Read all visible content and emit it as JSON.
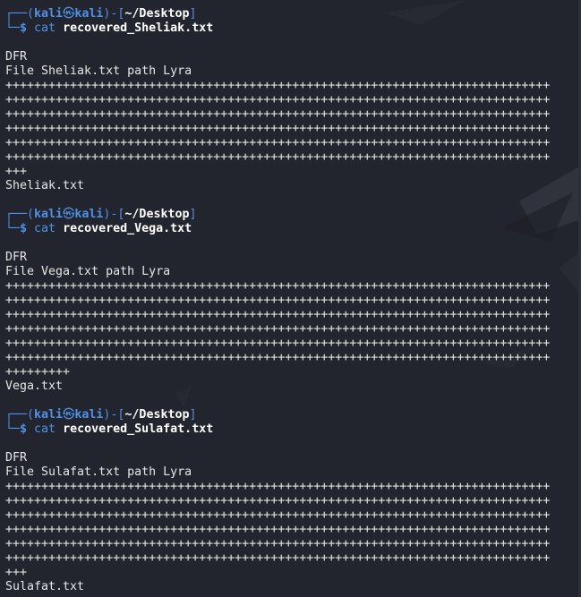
{
  "prompt": {
    "top_open": "┌──(",
    "user": "kali",
    "at_icon": "㉿",
    "host": "kali",
    "mid": ")-[",
    "path": "~/Desktop",
    "close": "]",
    "bottom": "└─",
    "dollar": "$"
  },
  "blocks": [
    {
      "command": "cat",
      "argument": "recovered_Sheliak.txt",
      "output": [
        "",
        "DFR",
        "File Sheliak.txt path Lyra",
        "++++++++++++++++++++++++++++++++++++++++++++++++++++++++++++++++++++++++++++",
        "++++++++++++++++++++++++++++++++++++++++++++++++++++++++++++++++++++++++++++",
        "++++++++++++++++++++++++++++++++++++++++++++++++++++++++++++++++++++++++++++",
        "++++++++++++++++++++++++++++++++++++++++++++++++++++++++++++++++++++++++++++",
        "++++++++++++++++++++++++++++++++++++++++++++++++++++++++++++++++++++++++++++",
        "++++++++++++++++++++++++++++++++++++++++++++++++++++++++++++++++++++++++++++",
        "+++",
        "Sheliak.txt"
      ]
    },
    {
      "command": "cat",
      "argument": "recovered_Vega.txt",
      "output": [
        "",
        "DFR",
        "File Vega.txt path Lyra",
        "++++++++++++++++++++++++++++++++++++++++++++++++++++++++++++++++++++++++++++",
        "++++++++++++++++++++++++++++++++++++++++++++++++++++++++++++++++++++++++++++",
        "++++++++++++++++++++++++++++++++++++++++++++++++++++++++++++++++++++++++++++",
        "++++++++++++++++++++++++++++++++++++++++++++++++++++++++++++++++++++++++++++",
        "++++++++++++++++++++++++++++++++++++++++++++++++++++++++++++++++++++++++++++",
        "++++++++++++++++++++++++++++++++++++++++++++++++++++++++++++++++++++++++++++",
        "+++++++++",
        "Vega.txt"
      ]
    },
    {
      "command": "cat",
      "argument": "recovered_Sulafat.txt",
      "output": [
        "",
        "DFR",
        "File Sulafat.txt path Lyra",
        "++++++++++++++++++++++++++++++++++++++++++++++++++++++++++++++++++++++++++++",
        "++++++++++++++++++++++++++++++++++++++++++++++++++++++++++++++++++++++++++++",
        "++++++++++++++++++++++++++++++++++++++++++++++++++++++++++++++++++++++++++++",
        "++++++++++++++++++++++++++++++++++++++++++++++++++++++++++++++++++++++++++++",
        "++++++++++++++++++++++++++++++++++++++++++++++++++++++++++++++++++++++++++++",
        "++++++++++++++++++++++++++++++++++++++++++++++++++++++++++++++++++++++++++++",
        "+++",
        "Sulafat.txt"
      ]
    }
  ],
  "colors": {
    "background": "#23252e",
    "prompt_blue": "#4f90e8",
    "text": "#e6e6e6",
    "bold_white": "#ffffff"
  }
}
